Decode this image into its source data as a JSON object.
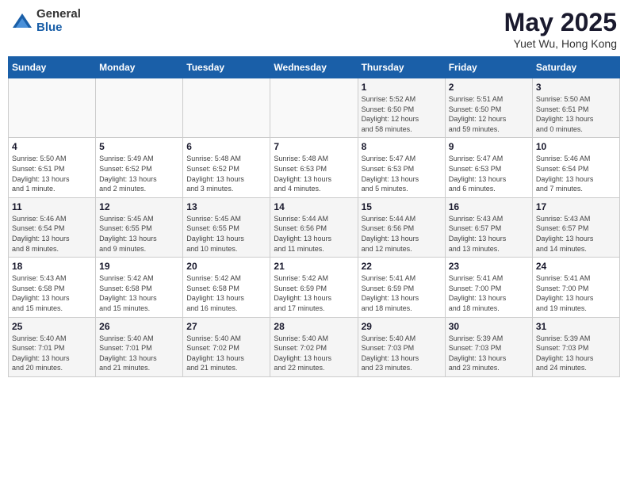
{
  "header": {
    "logo_general": "General",
    "logo_blue": "Blue",
    "month_title": "May 2025",
    "location": "Yuet Wu, Hong Kong"
  },
  "weekdays": [
    "Sunday",
    "Monday",
    "Tuesday",
    "Wednesday",
    "Thursday",
    "Friday",
    "Saturday"
  ],
  "weeks": [
    [
      {
        "day": "",
        "info": ""
      },
      {
        "day": "",
        "info": ""
      },
      {
        "day": "",
        "info": ""
      },
      {
        "day": "",
        "info": ""
      },
      {
        "day": "1",
        "info": "Sunrise: 5:52 AM\nSunset: 6:50 PM\nDaylight: 12 hours\nand 58 minutes."
      },
      {
        "day": "2",
        "info": "Sunrise: 5:51 AM\nSunset: 6:50 PM\nDaylight: 12 hours\nand 59 minutes."
      },
      {
        "day": "3",
        "info": "Sunrise: 5:50 AM\nSunset: 6:51 PM\nDaylight: 13 hours\nand 0 minutes."
      }
    ],
    [
      {
        "day": "4",
        "info": "Sunrise: 5:50 AM\nSunset: 6:51 PM\nDaylight: 13 hours\nand 1 minute."
      },
      {
        "day": "5",
        "info": "Sunrise: 5:49 AM\nSunset: 6:52 PM\nDaylight: 13 hours\nand 2 minutes."
      },
      {
        "day": "6",
        "info": "Sunrise: 5:48 AM\nSunset: 6:52 PM\nDaylight: 13 hours\nand 3 minutes."
      },
      {
        "day": "7",
        "info": "Sunrise: 5:48 AM\nSunset: 6:53 PM\nDaylight: 13 hours\nand 4 minutes."
      },
      {
        "day": "8",
        "info": "Sunrise: 5:47 AM\nSunset: 6:53 PM\nDaylight: 13 hours\nand 5 minutes."
      },
      {
        "day": "9",
        "info": "Sunrise: 5:47 AM\nSunset: 6:53 PM\nDaylight: 13 hours\nand 6 minutes."
      },
      {
        "day": "10",
        "info": "Sunrise: 5:46 AM\nSunset: 6:54 PM\nDaylight: 13 hours\nand 7 minutes."
      }
    ],
    [
      {
        "day": "11",
        "info": "Sunrise: 5:46 AM\nSunset: 6:54 PM\nDaylight: 13 hours\nand 8 minutes."
      },
      {
        "day": "12",
        "info": "Sunrise: 5:45 AM\nSunset: 6:55 PM\nDaylight: 13 hours\nand 9 minutes."
      },
      {
        "day": "13",
        "info": "Sunrise: 5:45 AM\nSunset: 6:55 PM\nDaylight: 13 hours\nand 10 minutes."
      },
      {
        "day": "14",
        "info": "Sunrise: 5:44 AM\nSunset: 6:56 PM\nDaylight: 13 hours\nand 11 minutes."
      },
      {
        "day": "15",
        "info": "Sunrise: 5:44 AM\nSunset: 6:56 PM\nDaylight: 13 hours\nand 12 minutes."
      },
      {
        "day": "16",
        "info": "Sunrise: 5:43 AM\nSunset: 6:57 PM\nDaylight: 13 hours\nand 13 minutes."
      },
      {
        "day": "17",
        "info": "Sunrise: 5:43 AM\nSunset: 6:57 PM\nDaylight: 13 hours\nand 14 minutes."
      }
    ],
    [
      {
        "day": "18",
        "info": "Sunrise: 5:43 AM\nSunset: 6:58 PM\nDaylight: 13 hours\nand 15 minutes."
      },
      {
        "day": "19",
        "info": "Sunrise: 5:42 AM\nSunset: 6:58 PM\nDaylight: 13 hours\nand 15 minutes."
      },
      {
        "day": "20",
        "info": "Sunrise: 5:42 AM\nSunset: 6:58 PM\nDaylight: 13 hours\nand 16 minutes."
      },
      {
        "day": "21",
        "info": "Sunrise: 5:42 AM\nSunset: 6:59 PM\nDaylight: 13 hours\nand 17 minutes."
      },
      {
        "day": "22",
        "info": "Sunrise: 5:41 AM\nSunset: 6:59 PM\nDaylight: 13 hours\nand 18 minutes."
      },
      {
        "day": "23",
        "info": "Sunrise: 5:41 AM\nSunset: 7:00 PM\nDaylight: 13 hours\nand 18 minutes."
      },
      {
        "day": "24",
        "info": "Sunrise: 5:41 AM\nSunset: 7:00 PM\nDaylight: 13 hours\nand 19 minutes."
      }
    ],
    [
      {
        "day": "25",
        "info": "Sunrise: 5:40 AM\nSunset: 7:01 PM\nDaylight: 13 hours\nand 20 minutes."
      },
      {
        "day": "26",
        "info": "Sunrise: 5:40 AM\nSunset: 7:01 PM\nDaylight: 13 hours\nand 21 minutes."
      },
      {
        "day": "27",
        "info": "Sunrise: 5:40 AM\nSunset: 7:02 PM\nDaylight: 13 hours\nand 21 minutes."
      },
      {
        "day": "28",
        "info": "Sunrise: 5:40 AM\nSunset: 7:02 PM\nDaylight: 13 hours\nand 22 minutes."
      },
      {
        "day": "29",
        "info": "Sunrise: 5:40 AM\nSunset: 7:03 PM\nDaylight: 13 hours\nand 23 minutes."
      },
      {
        "day": "30",
        "info": "Sunrise: 5:39 AM\nSunset: 7:03 PM\nDaylight: 13 hours\nand 23 minutes."
      },
      {
        "day": "31",
        "info": "Sunrise: 5:39 AM\nSunset: 7:03 PM\nDaylight: 13 hours\nand 24 minutes."
      }
    ]
  ]
}
